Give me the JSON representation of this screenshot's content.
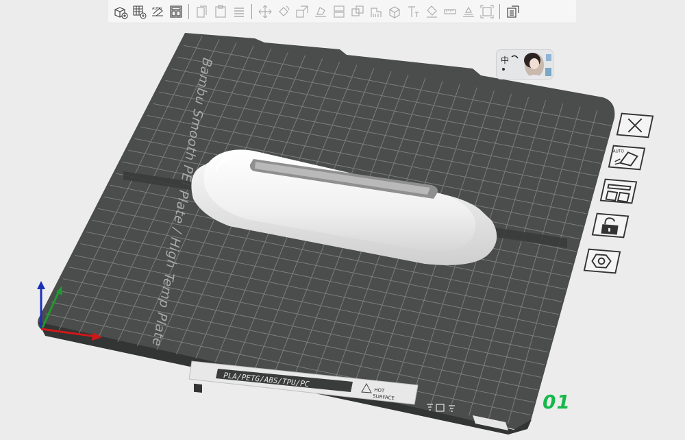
{
  "toolbar": {
    "buttons": [
      {
        "name": "add-object-icon",
        "dim": false
      },
      {
        "name": "add-plate-icon",
        "dim": false
      },
      {
        "name": "auto-orient-icon",
        "dim": false
      },
      {
        "name": "arrange-icon",
        "dim": false
      },
      {
        "sep": true
      },
      {
        "name": "copy-icon",
        "dim": true
      },
      {
        "name": "paste-icon",
        "dim": true
      },
      {
        "name": "layers-icon",
        "dim": true
      },
      {
        "sep": true
      },
      {
        "name": "move-icon",
        "dim": true
      },
      {
        "name": "rotate-icon",
        "dim": true
      },
      {
        "name": "scale-icon",
        "dim": true
      },
      {
        "name": "lay-on-face-icon",
        "dim": true
      },
      {
        "name": "cut-icon",
        "dim": true
      },
      {
        "name": "boolean-icon",
        "dim": true
      },
      {
        "name": "support-paint-icon",
        "dim": true
      },
      {
        "name": "seam-paint-icon",
        "dim": true
      },
      {
        "name": "text-icon",
        "dim": true
      },
      {
        "name": "color-paint-icon",
        "dim": true
      },
      {
        "name": "measure-icon",
        "dim": true
      },
      {
        "name": "assembly-icon",
        "dim": true
      },
      {
        "name": "fit-view-icon",
        "dim": true
      },
      {
        "sep": true
      },
      {
        "name": "variable-layer-icon",
        "dim": false
      }
    ]
  },
  "plate": {
    "name": "Bambu Smooth PEI Plate / High Temp Plate",
    "materials": "PLA/PETG/ABS/TPU/PC",
    "warning_line1": "HOT",
    "warning_line2": "SURFACE",
    "number": "01"
  },
  "thumbnail": {
    "lang_glyph": "中"
  },
  "side_toolbar": [
    {
      "name": "close-icon"
    },
    {
      "name": "auto-orient-plate-icon",
      "label": "AUTO"
    },
    {
      "name": "arrange-plate-icon"
    },
    {
      "name": "lock-icon"
    },
    {
      "name": "plate-settings-icon"
    }
  ],
  "colors": {
    "plate": "#4a4b4b",
    "grid": "#7d7e7e",
    "model": "#f2f2f2",
    "accent_green": "#17b84a"
  }
}
